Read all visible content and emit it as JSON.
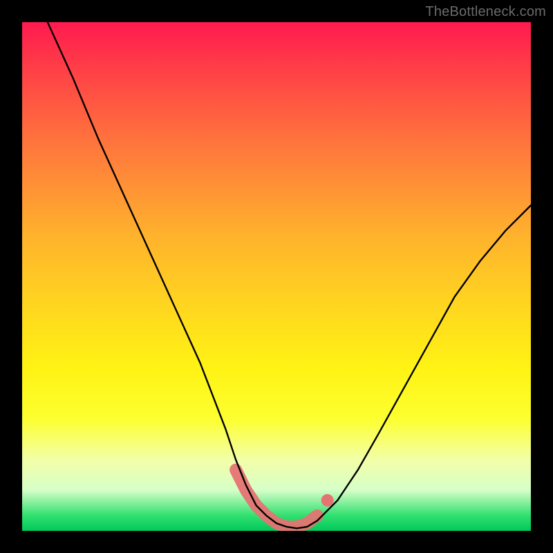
{
  "watermark": "TheBottleneck.com",
  "chart_data": {
    "type": "line",
    "title": "",
    "xlabel": "",
    "ylabel": "",
    "xlim": [
      0,
      100
    ],
    "ylim": [
      0,
      100
    ],
    "grid": false,
    "legend": false,
    "background_gradient": {
      "direction": "vertical",
      "stops": [
        {
          "pos": 0,
          "color": "#ff1a4f"
        },
        {
          "pos": 30,
          "color": "#ff8a38"
        },
        {
          "pos": 55,
          "color": "#ffd420"
        },
        {
          "pos": 78,
          "color": "#fcff30"
        },
        {
          "pos": 92,
          "color": "#d6ffc8"
        },
        {
          "pos": 100,
          "color": "#00c85a"
        }
      ]
    },
    "series": [
      {
        "name": "curve",
        "color": "#000000",
        "x": [
          5,
          10,
          15,
          20,
          25,
          30,
          35,
          40,
          42,
          44,
          46,
          48,
          50,
          52,
          54,
          56,
          58,
          62,
          66,
          70,
          75,
          80,
          85,
          90,
          95,
          100
        ],
        "y_percent": [
          100,
          89,
          77,
          66,
          55,
          44,
          33,
          20,
          14,
          9,
          5,
          3,
          1.5,
          0.8,
          0.5,
          0.8,
          2,
          6,
          12,
          19,
          28,
          37,
          46,
          53,
          59,
          64
        ],
        "note": "y_percent is percent of plot height from bottom (0 = bottom green, 100 = top red). Values estimated from pixels; no axis ticks shown."
      },
      {
        "name": "highlight-band",
        "color": "#e57373",
        "x": [
          42,
          44,
          46,
          48,
          50,
          52,
          54,
          56,
          58,
          60
        ],
        "y_percent": [
          12,
          8,
          5,
          3,
          1.5,
          0.8,
          0.8,
          1.5,
          3,
          6
        ],
        "note": "Thick reddish segment near the trough plus short detached dot around x≈60."
      }
    ]
  }
}
